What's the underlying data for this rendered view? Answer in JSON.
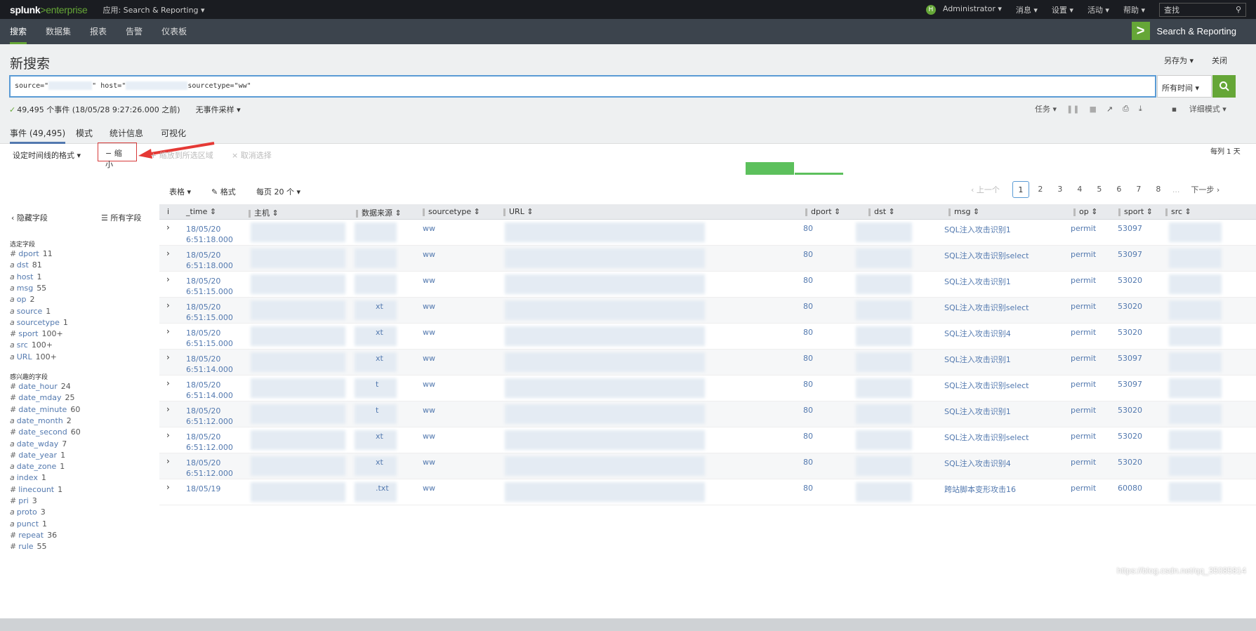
{
  "topbar": {
    "logo_splunk": "splunk",
    "logo_gt": ">",
    "logo_enterprise": "enterprise",
    "app_menu": "应用: Search & Reporting ▾",
    "user_initial": "H",
    "user": "Administrator ▾",
    "messages": "消息 ▾",
    "settings": "设置 ▾",
    "activity": "活动 ▾",
    "help": "帮助 ▾",
    "find_placeholder": "查找"
  },
  "nav": {
    "items": [
      "搜索",
      "数据集",
      "报表",
      "告警",
      "仪表板"
    ],
    "brand": "Search & Reporting"
  },
  "page": {
    "title": "新搜索",
    "save_as": "另存为 ▾",
    "close": "关闭"
  },
  "search": {
    "q1": "source=\"",
    "q2": "\" host=\"",
    "q3": "sourcetype=\"ww\"",
    "time_range": "所有时间 ▾"
  },
  "status": {
    "events": "49,495 个事件 (18/05/28 9:27:26.000 之前)",
    "sampling": "无事件采样 ▾",
    "job": "任务 ▾",
    "mode": "详细模式 ▾"
  },
  "tabs": [
    "事件 (49,495)",
    "模式",
    "统计信息",
    "可视化"
  ],
  "timeline": {
    "format": "设定时间线的格式 ▾",
    "zoom_out": "− 缩小",
    "zoom_selection": "+ 缩放到所选区域",
    "deselect": "× 取消选择",
    "per_day": "每列 1 天",
    "bars": [
      {
        "idx": 0,
        "value": 0.0
      },
      {
        "idx": 15,
        "value": 1.0
      },
      {
        "idx": 16,
        "value": 0.42
      },
      {
        "idx": 21,
        "value": 0.03
      }
    ]
  },
  "table_controls": {
    "table": "表格 ▾",
    "format": "✎ 格式",
    "per_page": "每页 20 个 ▾"
  },
  "pager": {
    "prev": "‹ 上一个",
    "pages": [
      "1",
      "2",
      "3",
      "4",
      "5",
      "6",
      "7",
      "8"
    ],
    "ellipsis": "...",
    "next": "下一步 ›"
  },
  "sidebar": {
    "hide_fields": "‹ 隐藏字段",
    "all_fields": "☰ 所有字段",
    "selected_title": "选定字段",
    "selected": [
      {
        "t": "#",
        "name": "dport",
        "count": "11"
      },
      {
        "t": "a",
        "name": "dst",
        "count": "81"
      },
      {
        "t": "a",
        "name": "host",
        "count": "1"
      },
      {
        "t": "a",
        "name": "msg",
        "count": "55"
      },
      {
        "t": "a",
        "name": "op",
        "count": "2"
      },
      {
        "t": "a",
        "name": "source",
        "count": "1"
      },
      {
        "t": "a",
        "name": "sourcetype",
        "count": "1"
      },
      {
        "t": "#",
        "name": "sport",
        "count": "100+"
      },
      {
        "t": "a",
        "name": "src",
        "count": "100+"
      },
      {
        "t": "a",
        "name": "URL",
        "count": "100+"
      }
    ],
    "interesting_title": "感兴趣的字段",
    "interesting": [
      {
        "t": "#",
        "name": "date_hour",
        "count": "24"
      },
      {
        "t": "#",
        "name": "date_mday",
        "count": "25"
      },
      {
        "t": "#",
        "name": "date_minute",
        "count": "60"
      },
      {
        "t": "a",
        "name": "date_month",
        "count": "2"
      },
      {
        "t": "#",
        "name": "date_second",
        "count": "60"
      },
      {
        "t": "a",
        "name": "date_wday",
        "count": "7"
      },
      {
        "t": "#",
        "name": "date_year",
        "count": "1"
      },
      {
        "t": "a",
        "name": "date_zone",
        "count": "1"
      },
      {
        "t": "a",
        "name": "index",
        "count": "1"
      },
      {
        "t": "#",
        "name": "linecount",
        "count": "1"
      },
      {
        "t": "#",
        "name": "pri",
        "count": "3"
      },
      {
        "t": "a",
        "name": "proto",
        "count": "3"
      },
      {
        "t": "a",
        "name": "punct",
        "count": "1"
      },
      {
        "t": "#",
        "name": "repeat",
        "count": "36"
      },
      {
        "t": "#",
        "name": "rule",
        "count": "55"
      }
    ]
  },
  "columns": [
    "i",
    "_time",
    "主机",
    "数据来源",
    "sourcetype",
    "URL",
    "dport",
    "dst",
    "msg",
    "op",
    "sport",
    "src"
  ],
  "rows": [
    {
      "d": "18/05/20",
      "t": "6:51:18.000",
      "src": "",
      "st": "ww",
      "dport": "80",
      "msg": "SQL注入攻击识别1",
      "op": "permit",
      "sport": "53097"
    },
    {
      "d": "18/05/20",
      "t": "6:51:18.000",
      "src": "",
      "st": "ww",
      "dport": "80",
      "msg": "SQL注入攻击识别select",
      "op": "permit",
      "sport": "53097"
    },
    {
      "d": "18/05/20",
      "t": "6:51:15.000",
      "src": "",
      "st": "ww",
      "dport": "80",
      "msg": "SQL注入攻击识别1",
      "op": "permit",
      "sport": "53020"
    },
    {
      "d": "18/05/20",
      "t": "6:51:15.000",
      "src": "xt",
      "st": "ww",
      "dport": "80",
      "msg": "SQL注入攻击识别select",
      "op": "permit",
      "sport": "53020"
    },
    {
      "d": "18/05/20",
      "t": "6:51:15.000",
      "src": "xt",
      "st": "ww",
      "dport": "80",
      "msg": "SQL注入攻击识别4",
      "op": "permit",
      "sport": "53020"
    },
    {
      "d": "18/05/20",
      "t": "6:51:14.000",
      "src": "xt",
      "st": "ww",
      "dport": "80",
      "msg": "SQL注入攻击识别1",
      "op": "permit",
      "sport": "53097"
    },
    {
      "d": "18/05/20",
      "t": "6:51:14.000",
      "src": "t",
      "st": "ww",
      "dport": "80",
      "msg": "SQL注入攻击识别select",
      "op": "permit",
      "sport": "53097"
    },
    {
      "d": "18/05/20",
      "t": "6:51:12.000",
      "src": "t",
      "st": "ww",
      "dport": "80",
      "msg": "SQL注入攻击识别1",
      "op": "permit",
      "sport": "53020"
    },
    {
      "d": "18/05/20",
      "t": "6:51:12.000",
      "src": "xt",
      "st": "ww",
      "dport": "80",
      "msg": "SQL注入攻击识别select",
      "op": "permit",
      "sport": "53020"
    },
    {
      "d": "18/05/20",
      "t": "6:51:12.000",
      "src": "xt",
      "st": "ww",
      "dport": "80",
      "msg": "SQL注入攻击识别4",
      "op": "permit",
      "sport": "53020"
    },
    {
      "d": "18/05/19",
      "t": "",
      "src": ".txt",
      "st": "ww",
      "dport": "80",
      "msg": "跨站脚本变形攻击16",
      "op": "permit",
      "sport": "60080"
    }
  ],
  "watermark": "https://blog.csdn.net/qq_35085814"
}
